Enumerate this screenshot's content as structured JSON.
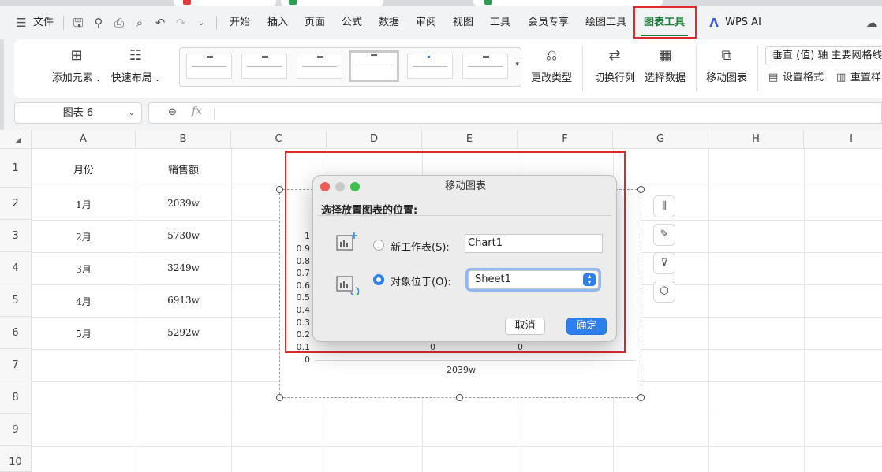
{
  "menu": {
    "file_label": "文件",
    "tabs": [
      "开始",
      "插入",
      "页面",
      "公式",
      "数据",
      "审阅",
      "视图",
      "工具",
      "会员专享",
      "绘图工具",
      "图表工具"
    ],
    "ai_label": "WPS AI"
  },
  "ribbon": {
    "add_element": "添加元素",
    "quick_layout": "快速布局",
    "change_type": "更改类型",
    "switch_row_col": "切换行列",
    "select_data": "选择数据",
    "move_chart": "移动图表",
    "element_select": "垂直 (值) 轴 主要网格线",
    "set_format": "设置格式",
    "reset_style": "重置样"
  },
  "formula_bar": {
    "name_box": "图表 6",
    "fx": "fx"
  },
  "sheet": {
    "columns": [
      "A",
      "B",
      "C",
      "D",
      "E",
      "F",
      "G",
      "H",
      "I"
    ],
    "rows": [
      "1",
      "2",
      "3",
      "4",
      "5",
      "6",
      "7",
      "8",
      "9",
      "10"
    ],
    "header": {
      "a": "月份",
      "b": "销售额"
    },
    "data": [
      {
        "month": "1月",
        "sales": "2039w"
      },
      {
        "month": "2月",
        "sales": "5730w"
      },
      {
        "month": "3月",
        "sales": "3249w"
      },
      {
        "month": "4月",
        "sales": "6913w"
      },
      {
        "month": "5月",
        "sales": "5292w"
      }
    ]
  },
  "chart": {
    "y_ticks": [
      "1",
      "0.9",
      "0.8",
      "0.7",
      "0.6",
      "0.5",
      "0.4",
      "0.3",
      "0.2",
      "0.1",
      "0"
    ],
    "x_label": "2039w",
    "zero_labels": [
      "0",
      "0"
    ]
  },
  "dialog": {
    "title": "移动图表",
    "subtitle": "选择放置图表的位置:",
    "option_new_sheet": "新工作表(S):",
    "new_sheet_value": "Chart1",
    "option_object_in": "对象位于(O):",
    "object_in_value": "Sheet1",
    "cancel": "取消",
    "ok": "确定"
  },
  "colors": {
    "accent_green": "#1e7d3a",
    "highlight_red": "#e02a2a",
    "primary_blue": "#2d7ff0"
  }
}
